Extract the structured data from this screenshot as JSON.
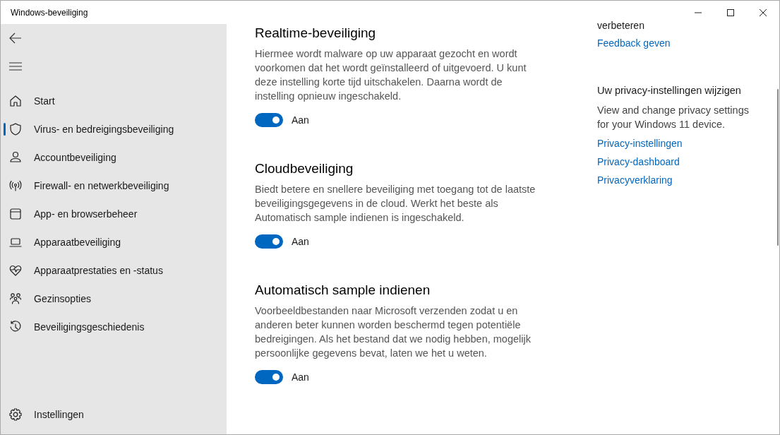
{
  "window": {
    "title": "Windows-beveiliging"
  },
  "sidebar": {
    "items": [
      {
        "label": "Start",
        "selected": false
      },
      {
        "label": "Virus- en bedreigingsbeveiliging",
        "selected": true
      },
      {
        "label": "Accountbeveiliging",
        "selected": false
      },
      {
        "label": "Firewall- en netwerkbeveiliging",
        "selected": false
      },
      {
        "label": "App- en browserbeheer",
        "selected": false
      },
      {
        "label": "Apparaatbeveiliging",
        "selected": false
      },
      {
        "label": "Apparaatprestaties en -status",
        "selected": false
      },
      {
        "label": "Gezinsopties",
        "selected": false
      },
      {
        "label": "Beveiligingsgeschiedenis",
        "selected": false
      }
    ],
    "settings": {
      "label": "Instellingen"
    }
  },
  "sections": [
    {
      "title": "Realtime-beveiliging",
      "description": "Hiermee wordt malware op uw apparaat gezocht en wordt voorkomen dat het wordt geïnstalleerd of uitgevoerd. U kunt deze instelling korte tijd uitschakelen. Daarna wordt de instelling opnieuw ingeschakeld.",
      "toggle": {
        "on": true,
        "label": "Aan"
      }
    },
    {
      "title": "Cloudbeveiliging",
      "description": "Biedt betere en snellere beveiliging met toegang tot de laatste beveiligingsgegevens in de cloud. Werkt het beste als Automatisch sample indienen is ingeschakeld.",
      "toggle": {
        "on": true,
        "label": "Aan"
      }
    },
    {
      "title": "Automatisch sample indienen",
      "description": "Voorbeeldbestanden naar Microsoft verzenden zodat u en anderen beter kunnen worden beschermd tegen potentiële bedreigingen. Als het bestand dat we nodig hebben, mogelijk persoonlijke gegevens bevat, laten we het u weten.",
      "toggle": {
        "on": true,
        "label": "Aan"
      }
    }
  ],
  "side_panel": {
    "partial_text": "verbeteren",
    "feedback_link": "Feedback geven",
    "privacy": {
      "title": "Uw privacy-instellingen wijzigen",
      "description": "View and change privacy settings for your Windows 11 device.",
      "links": [
        "Privacy-instellingen",
        "Privacy-dashboard",
        "Privacyverklaring"
      ]
    }
  }
}
